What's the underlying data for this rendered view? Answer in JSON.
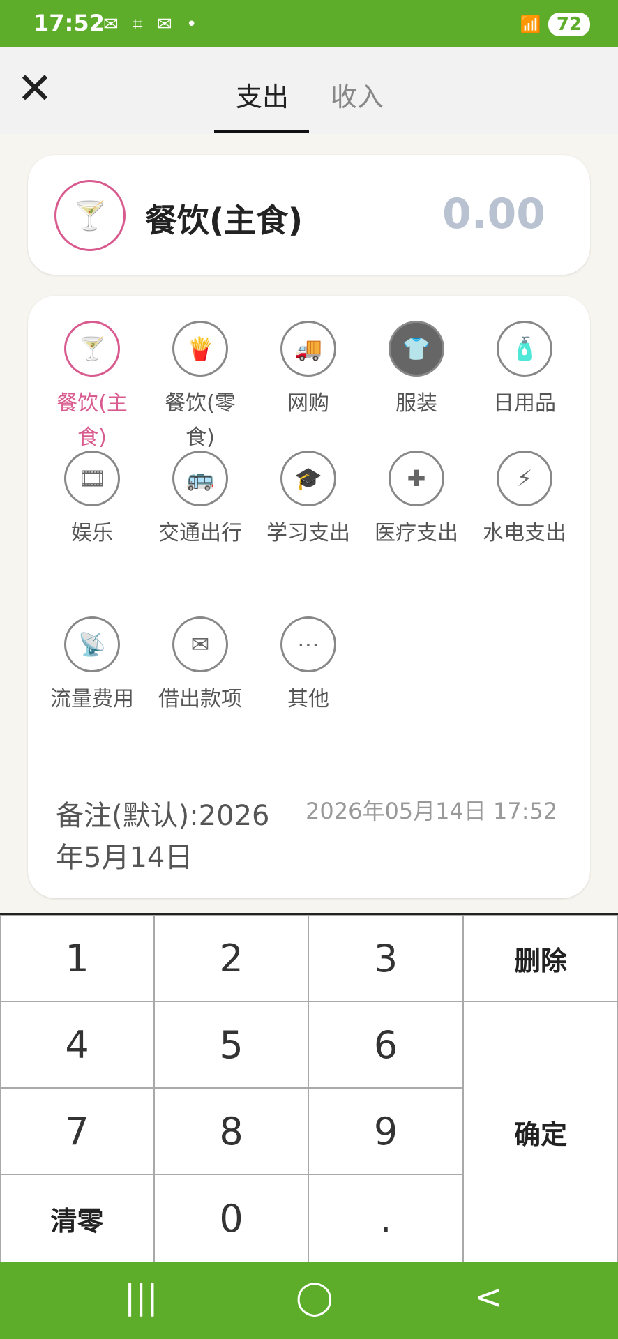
{
  "status": {
    "time": "17:52",
    "icons": "✉ ⌗ ✉ •",
    "signal": "📶",
    "battery": "72"
  },
  "tabs": [
    {
      "label": "支出"
    },
    {
      "label": "收入"
    }
  ],
  "selected": {
    "name": "餐饮(主食)",
    "amount": "0.00"
  },
  "categories": [
    {
      "label": "餐饮(主食)",
      "icon": "cocktail-icon",
      "glyph": "🍸"
    },
    {
      "label": "餐饮(零食)",
      "icon": "fries-icon",
      "glyph": "🍟"
    },
    {
      "label": "网购",
      "icon": "truck-icon",
      "glyph": "🚚"
    },
    {
      "label": "服装",
      "icon": "shirt-icon",
      "glyph": "👕"
    },
    {
      "label": "日用品",
      "icon": "toiletries-icon",
      "glyph": "🧴"
    },
    {
      "label": "娱乐",
      "icon": "film-reel-icon",
      "glyph": "🎞"
    },
    {
      "label": "交通出行",
      "icon": "bus-icon",
      "glyph": "🚌"
    },
    {
      "label": "学习支出",
      "icon": "graduation-cap-icon",
      "glyph": "🎓"
    },
    {
      "label": "医疗支出",
      "icon": "medicine-bottle-icon",
      "glyph": "✚"
    },
    {
      "label": "水电支出",
      "icon": "utility-drop-icon",
      "glyph": "⚡"
    },
    {
      "label": "流量费用",
      "icon": "router-icon",
      "glyph": "📡"
    },
    {
      "label": "借出款项",
      "icon": "envelope-icon",
      "glyph": "✉"
    },
    {
      "label": "其他",
      "icon": "more-icon",
      "glyph": "⋯"
    }
  ],
  "note": {
    "text": "备注(默认):2026年5月14日",
    "time": "2026年05月14日 17:52"
  },
  "keypad": {
    "k1": "1",
    "k2": "2",
    "k3": "3",
    "del": "删除",
    "k4": "4",
    "k5": "5",
    "k6": "6",
    "k7": "7",
    "k8": "8",
    "k9": "9",
    "confirm": "确定",
    "clear": "清零",
    "k0": "0",
    "dot": "."
  },
  "nav": {
    "recent": "|||",
    "home": "◯",
    "back": "<"
  }
}
